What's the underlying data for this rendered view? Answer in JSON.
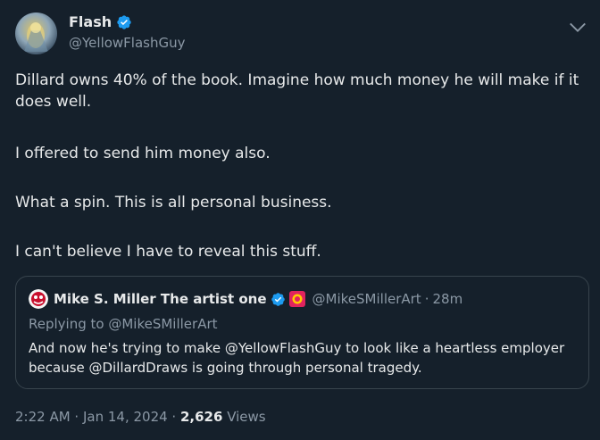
{
  "author": {
    "name": "Flash",
    "handle": "@YellowFlashGuy"
  },
  "tweet": {
    "paragraphs": [
      "Dillard owns 40% of the book. Imagine how much money he will make if it does well.",
      "I offered to send him money also.",
      "What a spin. This is all personal business.",
      "I can't believe I have to reveal this stuff."
    ]
  },
  "quote": {
    "name": "Mike S. Miller The artist one",
    "handle": "@MikeSMillerArt",
    "separator": "·",
    "time": "28m",
    "replying_prefix": "Replying to ",
    "replying_to": "@MikeSMillerArt",
    "text": "And now he's trying to make @YellowFlashGuy to look like a heartless employer because @DillardDraws is going through personal tragedy."
  },
  "meta": {
    "time": "2:22 AM",
    "separator1": " · ",
    "date": "Jan 14, 2024",
    "separator2": " · ",
    "views_count": "2,626",
    "views_label": " Views"
  },
  "colors": {
    "background": "#15202b",
    "text": "#e7e9ea",
    "secondary": "#8b98a5",
    "verified": "#1d9bf0",
    "border": "#38444d"
  },
  "icons": {
    "verified": "verified-badge-icon",
    "more": "chevron-down-icon"
  }
}
